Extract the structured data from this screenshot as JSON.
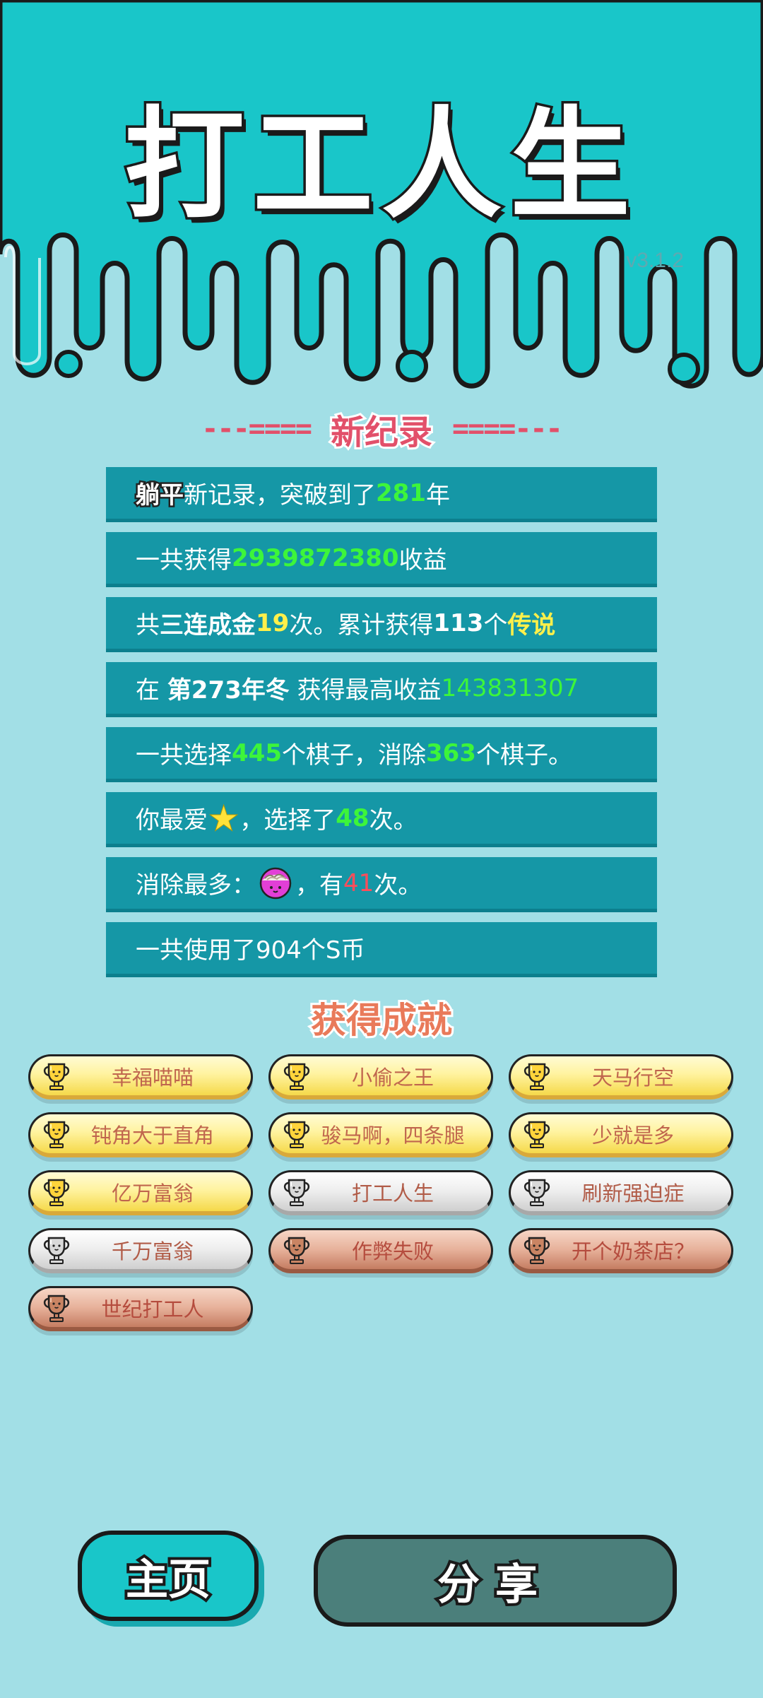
{
  "header": {
    "game_title": "打工人生",
    "version": "v3.1.2"
  },
  "new_record": {
    "title": "新纪录",
    "dashes_left": "---====",
    "dashes_right": "====---"
  },
  "records": {
    "r1": {
      "mode": "躺平",
      "text_a": "新记录，突破到了",
      "years": "281",
      "text_b": "年"
    },
    "r2": {
      "text_a": "一共获得",
      "amount": "2939872380",
      "text_b": "收益"
    },
    "r3": {
      "text_a": "共",
      "combo_label": "三连成金",
      "combo_count": "19",
      "text_b": "次。累计获得",
      "legend_count": "113",
      "text_c": "个",
      "legend_label": "传说"
    },
    "r4": {
      "text_a": "在",
      "season": "第273年冬",
      "text_b": "获得最高收益",
      "max_income": "143831307"
    },
    "r5": {
      "text_a": "一共选择",
      "chosen": "445",
      "text_b": "个棋子，消除",
      "eliminated": "363",
      "text_c": "个棋子。"
    },
    "r6": {
      "text_a": "你最爱",
      "fav_icon": "star-icon",
      "text_b": "，选择了",
      "times": "48",
      "text_c": "次。"
    },
    "r7": {
      "text_a": "消除最多：",
      "piece_icon": "noodle-bowl-icon",
      "text_b": "，有",
      "times": "41",
      "text_c": "次。"
    },
    "r8": {
      "text": "一共使用了904个S币"
    }
  },
  "achievements": {
    "title": "获得成就",
    "items": [
      {
        "label": "幸福喵喵",
        "tier": "gold"
      },
      {
        "label": "小偷之王",
        "tier": "gold"
      },
      {
        "label": "天马行空",
        "tier": "gold"
      },
      {
        "label": "钝角大于直角",
        "tier": "gold"
      },
      {
        "label": "骏马啊，四条腿",
        "tier": "gold"
      },
      {
        "label": "少就是多",
        "tier": "gold"
      },
      {
        "label": "亿万富翁",
        "tier": "gold"
      },
      {
        "label": "打工人生",
        "tier": "silver"
      },
      {
        "label": "刷新强迫症",
        "tier": "silver"
      },
      {
        "label": "千万富翁",
        "tier": "silver"
      },
      {
        "label": "作弊失败",
        "tier": "bronze"
      },
      {
        "label": "开个奶茶店？",
        "tier": "bronze"
      },
      {
        "label": "世纪打工人",
        "tier": "bronze"
      }
    ]
  },
  "buttons": {
    "home": "主页",
    "share": "分享"
  },
  "colors": {
    "header_teal": "#19c6c9",
    "background": "#a2dfe6",
    "record_row": "#1597a6",
    "highlight_green": "#3df53a",
    "highlight_yellow": "#fff04a",
    "highlight_red": "#ff4d5a",
    "title_red": "#e2506a"
  }
}
